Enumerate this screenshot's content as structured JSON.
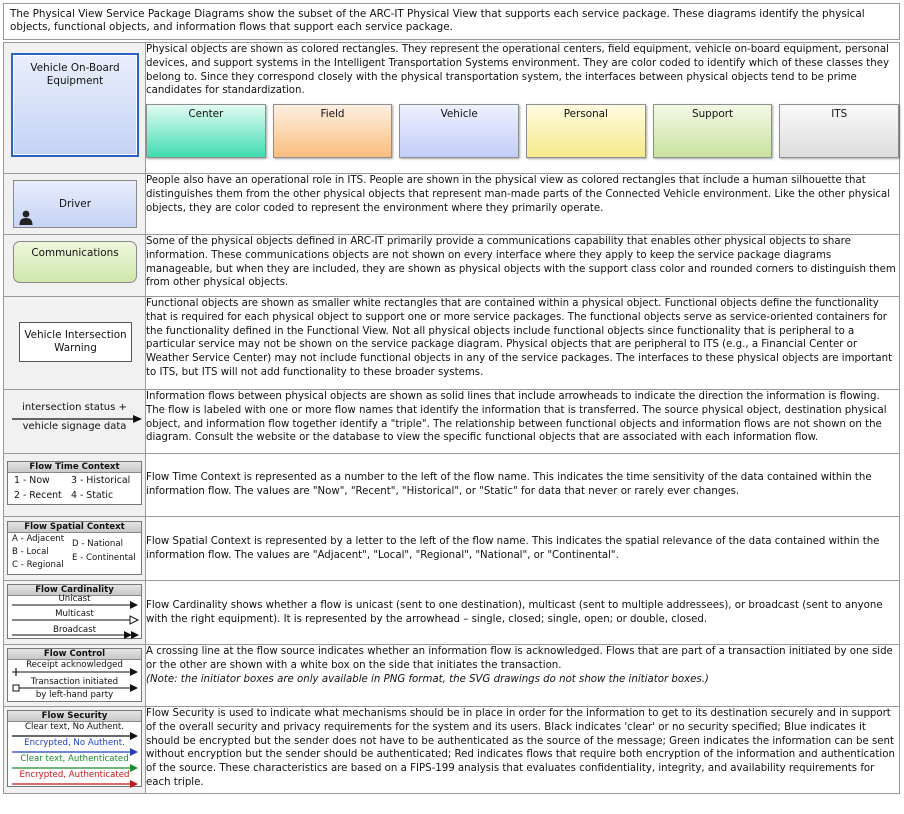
{
  "intro": "The Physical View Service Package Diagrams show the subset of the ARC-IT Physical View that supports each service package.  These diagrams identify the physical objects, functional objects, and information flows that support each service package.",
  "physical": {
    "box_label": "Vehicle On-Board Equipment",
    "desc": "Physical objects are shown as colored rectangles.  They represent the operational centers, field equipment, vehicle on-board equipment, personal devices, and support systems in the Intelligent Transportation Systems environment.  They are color coded to identify which of these classes they belong to.  Since they correspond closely with the physical transportation system, the interfaces between physical objects tend to be prime candidates for standardization.",
    "classes": [
      {
        "label": "Center",
        "color_top": "#e2fbf3",
        "color_bottom": "#3fdcb0"
      },
      {
        "label": "Field",
        "color_top": "#fff0e2",
        "color_bottom": "#f9bd7e"
      },
      {
        "label": "Vehicle",
        "color_top": "#eef1ff",
        "color_bottom": "#c3cdf7"
      },
      {
        "label": "Personal",
        "color_top": "#fffbe0",
        "color_bottom": "#f6ea8c"
      },
      {
        "label": "Support",
        "color_top": "#f4f9e6",
        "color_bottom": "#c9e2a0"
      },
      {
        "label": "ITS",
        "color_top": "#fafafa",
        "color_bottom": "#dcdcdc"
      }
    ]
  },
  "driver": {
    "box_label": "Driver",
    "desc": "People also have an operational role in ITS.  People are shown in the physical view as colored rectangles that include a human silhouette that distinguishes them from the other physical objects that represent man-made parts of the Connected Vehicle environment.  Like the other physical objects, they are color coded to represent the environment where they primarily operate."
  },
  "communications": {
    "box_label": "Communications",
    "desc": "Some of the physical objects defined in ARC-IT primarily provide a communications capability that enables other physical objects to share information.  These communications objects are not shown on every interface where they apply to keep the service package diagrams manageable, but when they are included, they are shown as physical objects with the support class color and rounded corners to distinguish them from other physical objects."
  },
  "functional": {
    "box_label": "Vehicle Intersection Warning",
    "desc": "Functional objects are shown as smaller white rectangles that are contained within a physical object.  Functional objects define the functionality that is required for each physical object to support one or more service packages.  The functional objects serve as service-oriented containers for the functionality defined in the Functional View.  Not all physical objects include functional objects since functionality that is peripheral to a particular service may not be shown on the service package diagram.  Physical objects that are peripheral to ITS (e.g., a Financial Center or Weather Service Center) may not include functional objects in any of the service packages.  The interfaces to these physical objects are important to ITS, but ITS will not add functionality to these broader systems."
  },
  "info_flow": {
    "label_top": "intersection status +",
    "label_bottom": "vehicle signage data",
    "desc": "Information flows between physical objects are shown as solid lines that include arrowheads to indicate the direction the information is flowing.  The flow is labeled with one or more flow names that identify the information that is transferred.  The source physical object, destination physical object, and information flow together identify a \"triple\".  The relationship between functional objects and information flows are not shown on the diagram.  Consult the website or the database to view the specific functional objects that are associated with each information flow."
  },
  "time_context": {
    "header": "Flow Time Context",
    "items": [
      "1 - Now",
      "3 - Historical",
      "2 - Recent",
      "4 - Static"
    ],
    "desc": "Flow Time Context is represented as a number to the left of the flow name. This indicates the time sensitivity of the data contained within the information flow. The values are \"Now\", \"Recent\", \"Historical\", or \"Static\" for data that never or rarely ever changes."
  },
  "spatial_context": {
    "header": "Flow Spatial Context",
    "items": [
      "A - Adjacent",
      "B - Local",
      "C - Regional",
      "D - National",
      "E - Continental"
    ],
    "desc": "Flow Spatial Context is represented by a letter to the left of the flow name. This indicates the spatial relevance of the data contained within the information flow. The values are \"Adjacent\", \"Local\", \"Regional\", \"National\", or \"Continental\"."
  },
  "cardinality": {
    "header": "Flow Cardinality",
    "items": [
      "Unicast",
      "Multicast",
      "Broadcast"
    ],
    "desc": "Flow Cardinality shows whether a flow is unicast (sent to one destination), multicast (sent to multiple addressees), or broadcast (sent to anyone with the right equipment).  It is represented by the arrowhead – single, closed; single, open; or double, closed."
  },
  "control": {
    "header": "Flow Control",
    "items": [
      "Receipt acknowledged",
      "Transaction initiated",
      "by left-hand party"
    ],
    "desc": "A crossing line at the flow source indicates whether an information flow is acknowledged.  Flows that are part of a transaction initiated by one side or the other are shown with a white box on the side that initiates the transaction.",
    "note": "(Note: the initiator boxes are only available in PNG format, the SVG drawings do not show the initiator boxes.)"
  },
  "security": {
    "header": "Flow Security",
    "items": [
      {
        "label": "Clear text, No Authent.",
        "color": "#111111"
      },
      {
        "label": "Encrypted, No Authent.",
        "color": "#1f3fbf"
      },
      {
        "label": "Clear text, Authenticated",
        "color": "#1a8a2a"
      },
      {
        "label": "Encrypted, Authenticated",
        "color": "#c01818"
      }
    ],
    "desc": "Flow Security is used to indicate what mechanisms should be in place in order for the information to get to its destination securely and in support of the overall security and privacy requirements for the system and its users.  Black indicates 'clear' or no security specified; Blue indicates it should be encrypted but the sender does not have to be authenticated as the source of the message; Green indicates the information can be sent without encryption but the sender should be authenticated; Red indicates flows that require both encryption of the information and authentication of the source.  These characteristics are based on a FIPS-199 analysis that evaluates confidentiality, integrity, and availability requirements for each triple."
  }
}
